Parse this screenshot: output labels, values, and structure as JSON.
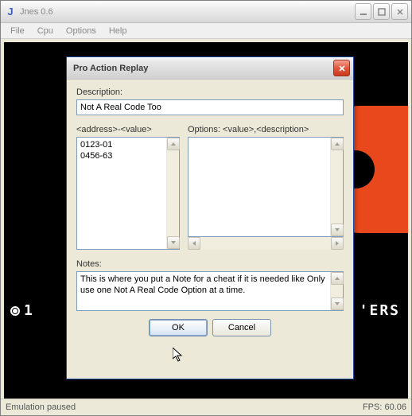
{
  "window": {
    "title": "Jnes 0.6",
    "menus": [
      "File",
      "Cpu",
      "Options",
      "Help"
    ]
  },
  "game": {
    "left_text": "1",
    "right_text": "'ERS"
  },
  "status": {
    "left": "Emulation paused",
    "right": "FPS: 60.06"
  },
  "dialog": {
    "title": "Pro Action Replay",
    "description_label": "Description:",
    "description_value": "Not A Real Code Too",
    "list_header": "<address>-<value>",
    "options_header": "Options: <value>,<description>",
    "codes": [
      "0123-01",
      "0456-63"
    ],
    "notes_label": "Notes:",
    "notes_value": "This is where you put a Note for a cheat if it is needed like Only use one Not A Real Code Option at a time.",
    "ok_label": "OK",
    "cancel_label": "Cancel"
  }
}
